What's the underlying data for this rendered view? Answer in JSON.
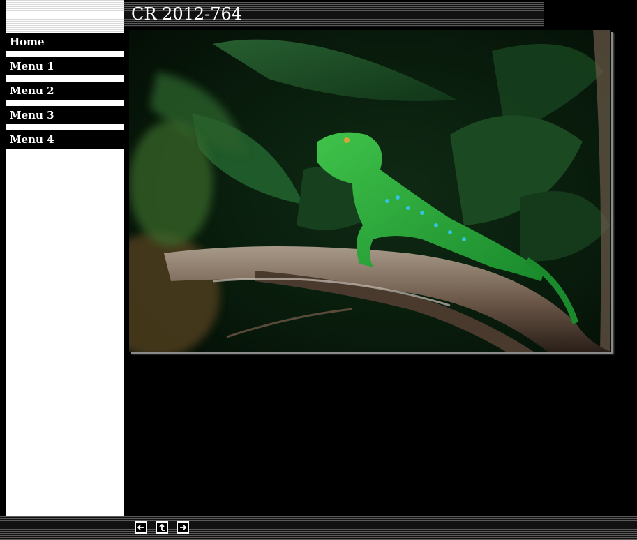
{
  "title": "CR 2012-764",
  "nav": {
    "items": [
      {
        "label": "Home"
      },
      {
        "label": "Menu 1"
      },
      {
        "label": "Menu 2"
      },
      {
        "label": "Menu 3"
      },
      {
        "label": "Menu 4"
      }
    ]
  },
  "photo": {
    "icon": "photo-lizard"
  },
  "pager": {
    "buttons": [
      {
        "icon": "arrow-left-icon"
      },
      {
        "icon": "arrow-up-icon"
      },
      {
        "icon": "arrow-right-icon"
      }
    ]
  },
  "colors": {
    "background": "#000000",
    "sidebar": "#ffffff",
    "text": "#ffffff"
  }
}
